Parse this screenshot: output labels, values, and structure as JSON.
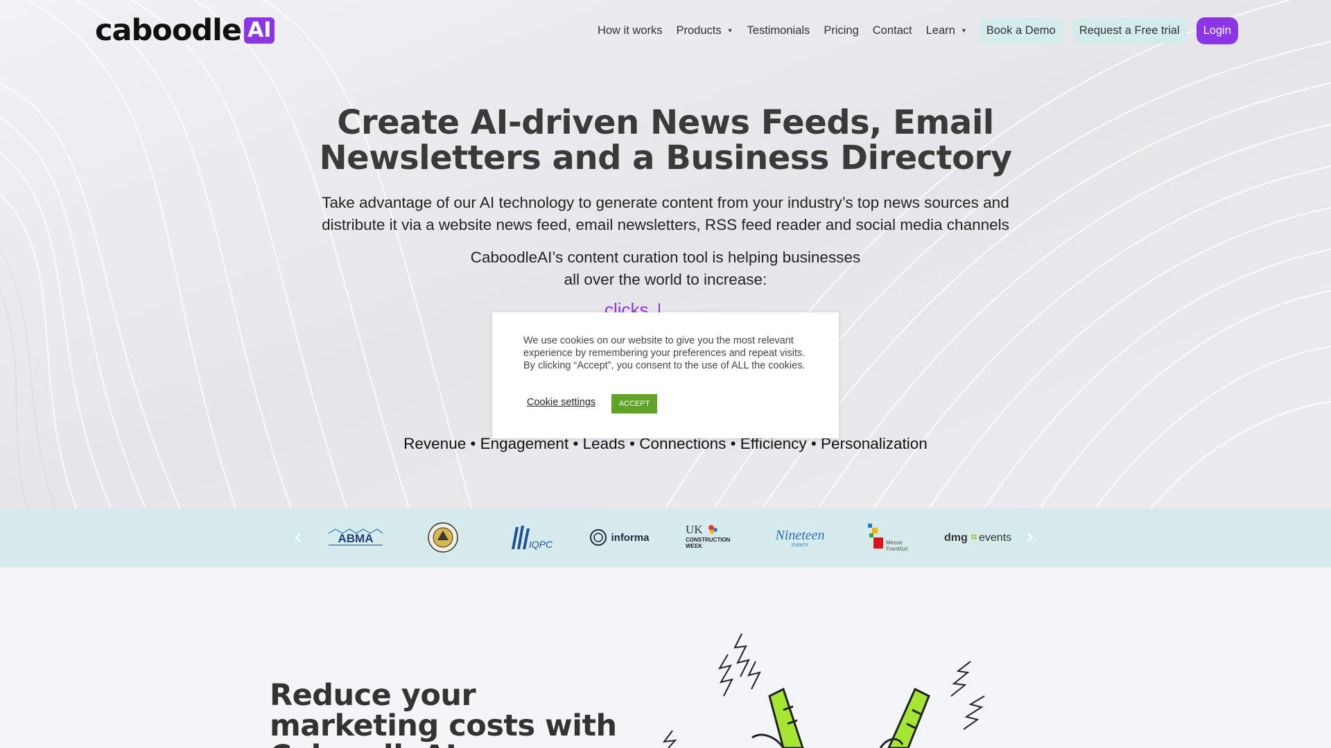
{
  "brand": {
    "logo_text": "caboodle",
    "logo_badge": "AI",
    "accent_color": "#8c35e6"
  },
  "nav": {
    "items": [
      {
        "label": "How it works",
        "has_caret": false
      },
      {
        "label": "Products",
        "has_caret": true
      },
      {
        "label": "Testimonials",
        "has_caret": false
      },
      {
        "label": "Pricing",
        "has_caret": false
      },
      {
        "label": "Contact",
        "has_caret": false
      },
      {
        "label": "Learn",
        "has_caret": true
      }
    ],
    "demo_label": "Book a Demo",
    "trial_label": "Request a Free trial",
    "login_label": "Login"
  },
  "hero": {
    "title_line1": "Create AI-driven News Feeds, Email",
    "title_line2": "Newsletters and a Business Directory",
    "sub_line1": "Take advantage of our AI technology to generate content from your industry’s top news sources and",
    "sub_line2": "distribute it via a website news feed, email newsletters, RSS feed reader and social media channels",
    "sub2_line1": "CaboodleAI’s content curation tool is helping businesses",
    "sub2_line2": "all over the world to increase:",
    "typed_word": "clicks",
    "benefits": "Revenue • Engagement • Leads • Connections • Efficiency • Personalization"
  },
  "cookie": {
    "text": "We use cookies on our website to give you the most relevant experience by remembering your preferences and repeat visits. By clicking “Accept”, you consent to the use of ALL the cookies.",
    "settings_label": "Cookie settings",
    "accept_label": "ACCEPT"
  },
  "clients": {
    "prev_icon": "chevron-left-icon",
    "next_icon": "chevron-right-icon",
    "logos": [
      {
        "name": "ABMA",
        "text": "ABMA"
      },
      {
        "name": "seal",
        "text": ""
      },
      {
        "name": "IQPC",
        "text": "IQPC"
      },
      {
        "name": "informa",
        "text": "informa"
      },
      {
        "name": "UK Construction Week",
        "text": "UK CONSTRUCTION WEEK"
      },
      {
        "name": "Nineteen Events",
        "text": "Nineteen"
      },
      {
        "name": "Messe Frankfurt",
        "text": "Messe Frankfurt"
      },
      {
        "name": "dmg events",
        "text": "dmg::events"
      }
    ]
  },
  "lower": {
    "title": "Reduce your marketing costs with CaboodleAI"
  }
}
